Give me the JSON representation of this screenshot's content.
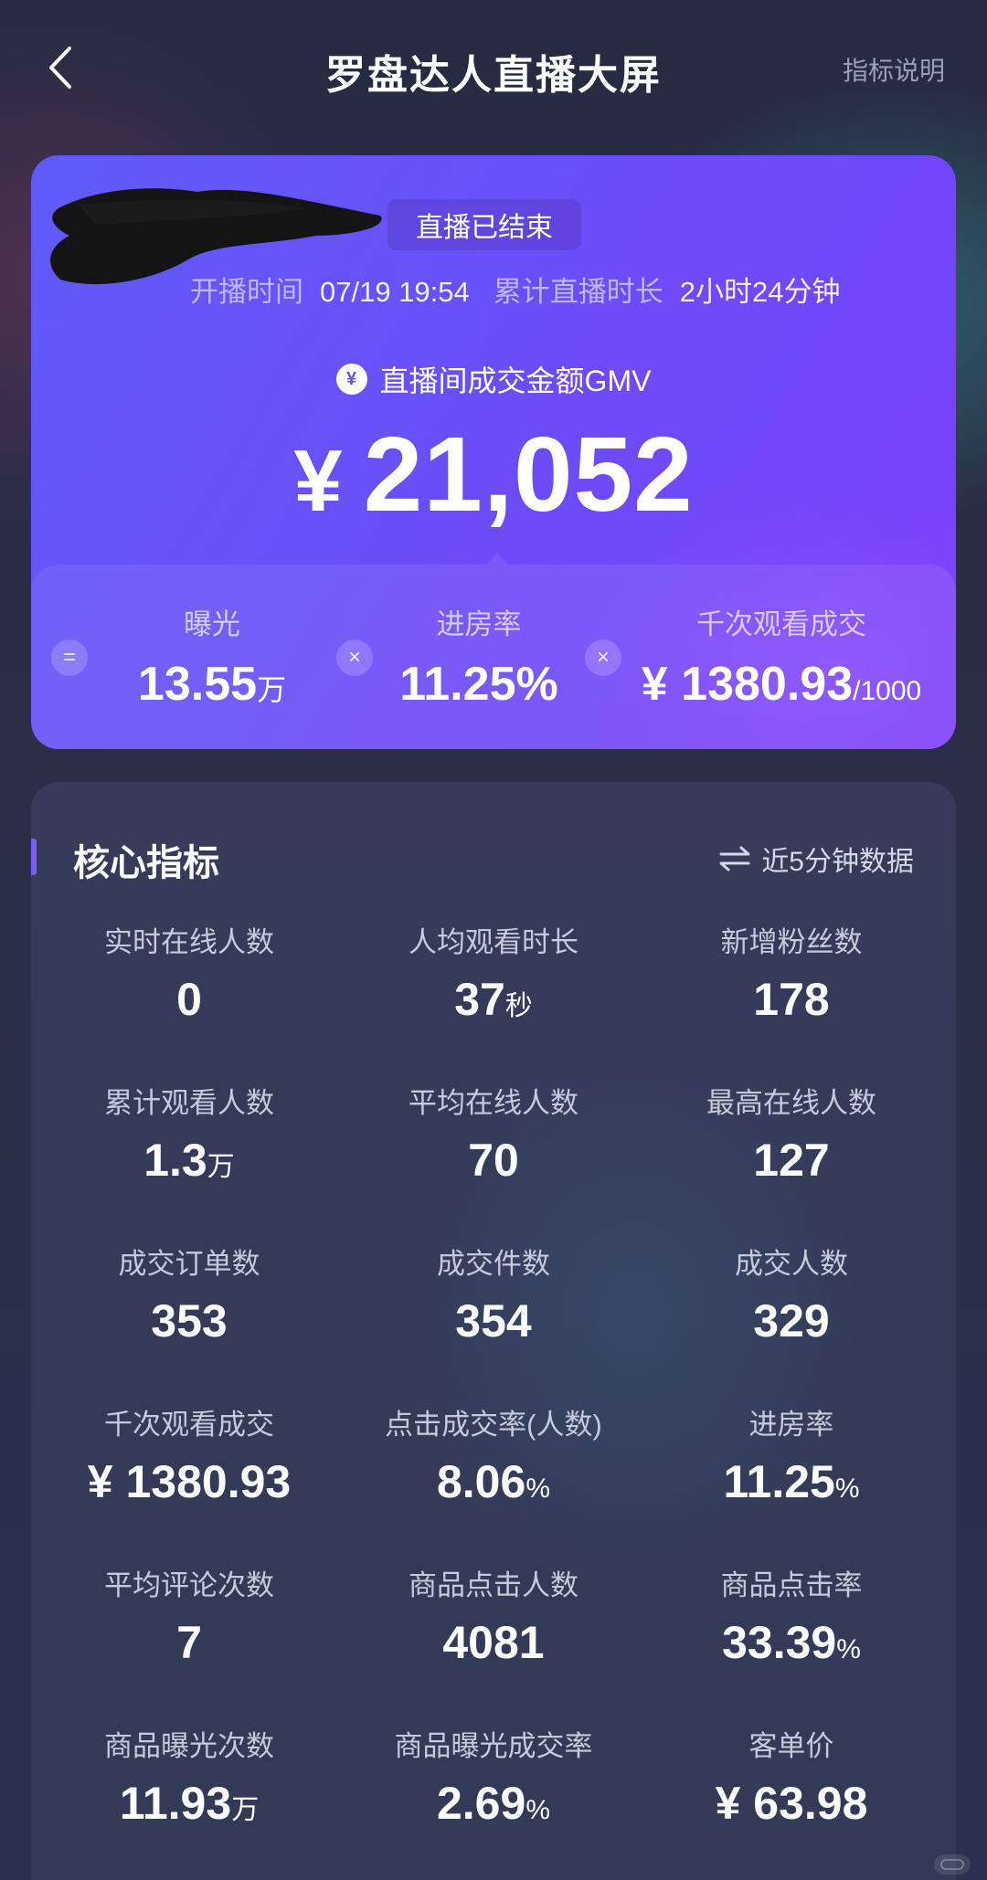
{
  "header": {
    "title": "罗盘达人直播大屏",
    "help_label": "指标说明"
  },
  "hero": {
    "status_badge": "直播已结束",
    "start_time_label": "开播时间",
    "start_time_value": "07/19 19:54",
    "duration_label": "累计直播时长",
    "duration_value": "2小时24分钟",
    "gmv_label": "直播间成交金额GMV",
    "gmv_currency": "¥",
    "gmv_value": "21,052",
    "yen_icon_glyph": "¥",
    "operators": [
      "=",
      "×",
      "×"
    ],
    "metrics": [
      {
        "label": "曝光",
        "value": "13.55",
        "unit": "万"
      },
      {
        "label": "进房率",
        "value": "11.25%",
        "unit": ""
      },
      {
        "label": "千次观看成交",
        "value": "¥ 1380.93",
        "unit": "/1000"
      }
    ]
  },
  "core": {
    "title": "核心指标",
    "toggle_label": "近5分钟数据",
    "cells": [
      {
        "label": "实时在线人数",
        "value": "0",
        "unit": ""
      },
      {
        "label": "人均观看时长",
        "value": "37",
        "unit": "秒"
      },
      {
        "label": "新增粉丝数",
        "value": "178",
        "unit": ""
      },
      {
        "label": "累计观看人数",
        "value": "1.3",
        "unit": "万"
      },
      {
        "label": "平均在线人数",
        "value": "70",
        "unit": ""
      },
      {
        "label": "最高在线人数",
        "value": "127",
        "unit": ""
      },
      {
        "label": "成交订单数",
        "value": "353",
        "unit": ""
      },
      {
        "label": "成交件数",
        "value": "354",
        "unit": ""
      },
      {
        "label": "成交人数",
        "value": "329",
        "unit": ""
      },
      {
        "label": "千次观看成交",
        "value": "¥ 1380.93",
        "unit": ""
      },
      {
        "label": "点击成交率(人数)",
        "value": "8.06",
        "unit": "%"
      },
      {
        "label": "进房率",
        "value": "11.25",
        "unit": "%"
      },
      {
        "label": "平均评论次数",
        "value": "7",
        "unit": ""
      },
      {
        "label": "商品点击人数",
        "value": "4081",
        "unit": ""
      },
      {
        "label": "商品点击率",
        "value": "33.39",
        "unit": "%"
      },
      {
        "label": "商品曝光次数",
        "value": "11.93",
        "unit": "万"
      },
      {
        "label": "商品曝光成交率",
        "value": "2.69",
        "unit": "%"
      },
      {
        "label": "客单价",
        "value": "¥ 63.98",
        "unit": ""
      }
    ]
  },
  "colors": {
    "background": "#262b43",
    "hero_start": "#5f5bf6",
    "hero_end": "#7a3ffb",
    "accent": "#7a5cff"
  }
}
